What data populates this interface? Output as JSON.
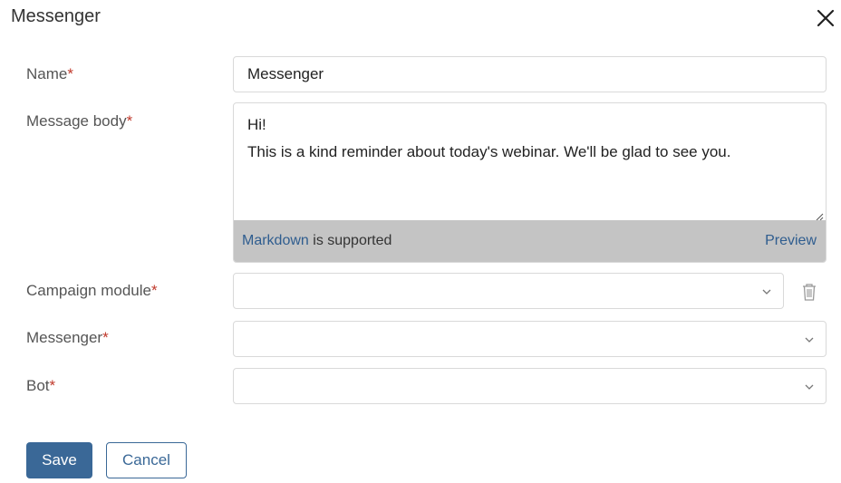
{
  "dialog": {
    "title": "Messenger",
    "close_icon": "close-icon"
  },
  "form": {
    "required_mark": "*",
    "name": {
      "label": "Name",
      "value": "Messenger"
    },
    "message_body": {
      "label": "Message body",
      "lines": [
        "Hi!",
        "This is a kind reminder about today's webinar. We'll be glad to see you."
      ],
      "markdown_link": "Markdown",
      "markdown_suffix": " is supported",
      "preview_label": "Preview"
    },
    "campaign_module": {
      "label": "Campaign module",
      "value": ""
    },
    "messenger": {
      "label": "Messenger",
      "value": ""
    },
    "bot": {
      "label": "Bot",
      "value": ""
    }
  },
  "actions": {
    "save_label": "Save",
    "cancel_label": "Cancel"
  },
  "colors": {
    "primary": "#3a6897",
    "link": "#2f5d8f",
    "required": "#c0392b",
    "markdown_bar": "#c4c4c4"
  }
}
